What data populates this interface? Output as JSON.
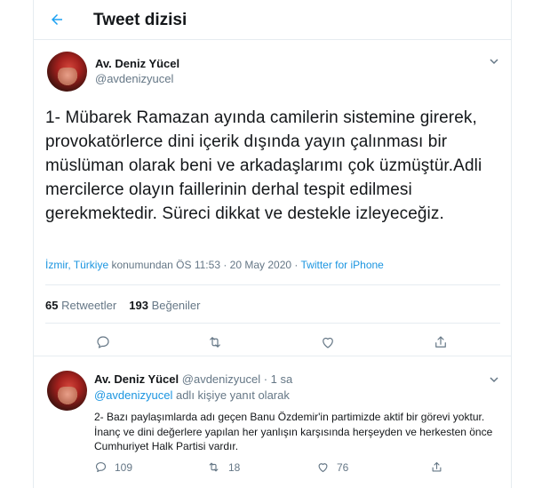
{
  "header": {
    "title": "Tweet dizisi"
  },
  "main_tweet": {
    "author_name": "Av. Deniz Yücel",
    "handle": "@avdenizyucel",
    "text": "1- Mübarek Ramazan ayında camilerin sistemine girerek, provokatörlerce dini içerik dışında yayın çalınması bir müslüman olarak beni ve arkadaşlarımı çok üzmüştür.Adli mercilerce olayın faillerinin derhal tespit edilmesi gerekmektedir. Süreci dikkat ve destekle izleyeceğiz.",
    "location": "İzmir, Türkiye",
    "location_suffix": " konumundan ÖS 11:53 · 20 May 2020 · ",
    "source": "Twitter for iPhone",
    "retweets_count": "65",
    "retweets_label": "Retweetler",
    "likes_count": "193",
    "likes_label": "Beğeniler"
  },
  "reply_tweet": {
    "author_name": "Av. Deniz Yücel",
    "handle_time": "@avdenizyucel · 1 sa",
    "reply_to_handle": "@avdenizyucel",
    "reply_to_suffix": " adlı kişiye yanıt olarak",
    "text": "2- Bazı paylaşımlarda adı geçen Banu Özdemir'in partimizde aktif bir görevi yoktur. İnanç ve dini değerlere yapılan her yanlışın karşısında herşeyden ve herkesten önce Cumhuriyet Halk Partisi vardır.",
    "reply_count": "109",
    "retweet_count": "18",
    "like_count": "76"
  },
  "colors": {
    "accent": "#1da1f2",
    "link": "#1b95e0",
    "muted": "#657786",
    "text": "#14171a",
    "border": "#e6ecf0"
  },
  "icons": [
    "back-arrow-icon",
    "chevron-down-icon",
    "reply-icon",
    "retweet-icon",
    "like-icon",
    "share-icon"
  ]
}
